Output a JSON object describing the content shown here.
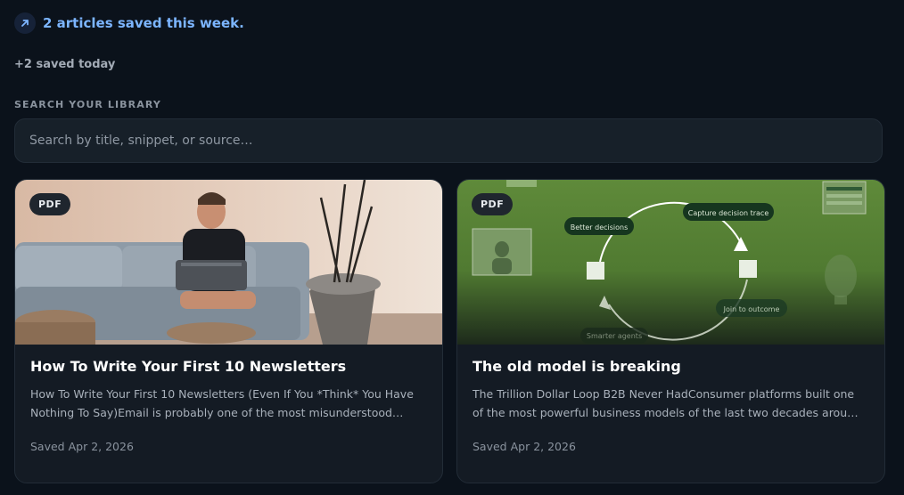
{
  "header": {
    "stat_title": "2 articles saved this week.",
    "stat_icon": "arrow-up-right-icon",
    "sub_stat": "+2 saved today"
  },
  "search": {
    "label": "SEARCH YOUR LIBRARY",
    "placeholder": "Search by title, snippet, or source…",
    "value": ""
  },
  "cards": [
    {
      "badge": "PDF",
      "title": "How To Write Your First 10 Newsletters",
      "snippet": "How To Write Your First 10 Newsletters (Even If You *Think* You Have Nothing To Say)Email is probably one of the most misunderstood…",
      "date": "Saved Apr 2, 2026"
    },
    {
      "badge": "PDF",
      "title": "The old model is breaking",
      "snippet": "The Trillion Dollar Loop B2B Never HadConsumer platforms built one of the most powerful business models of the last two decades around a…",
      "date": "Saved Apr 2, 2026",
      "diagram": {
        "labels": [
          "Better decisions",
          "Capture decision trace",
          "Join to outcome",
          "Smarter agents"
        ]
      }
    }
  ],
  "colors": {
    "background": "#0b121b",
    "accent": "#7cb5ff",
    "card": "#141b24",
    "thumb_green": "#5f8a3a"
  }
}
